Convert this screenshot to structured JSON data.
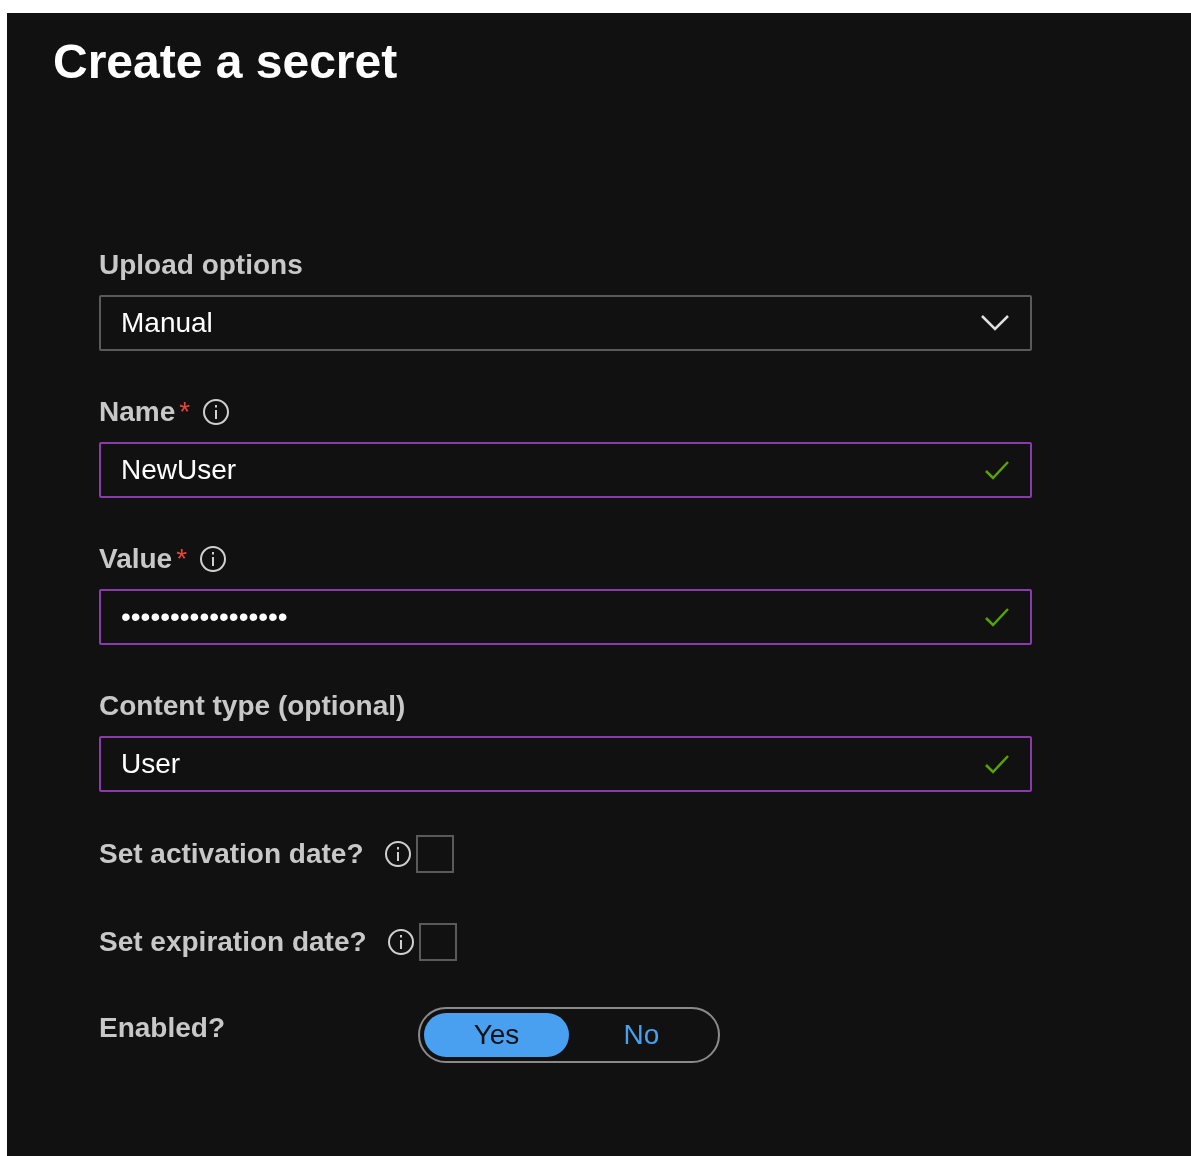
{
  "title": "Create a secret",
  "fields": [
    {
      "kind": "dropdown",
      "label": "Upload options",
      "value": "Manual",
      "info": false,
      "valid": false
    },
    {
      "kind": "text",
      "label": "Name",
      "required_mark": "*",
      "info": true,
      "value": "NewUser",
      "valid": true
    },
    {
      "kind": "text",
      "label": "Value",
      "required_mark": "*",
      "info": true,
      "value": "•••••••••••••••••",
      "valid": true
    },
    {
      "kind": "text",
      "label": "Content type (optional)",
      "info": false,
      "value": "User",
      "valid": true
    }
  ],
  "checkboxes": [
    {
      "label": "Set activation date?",
      "info": true,
      "checked": false
    },
    {
      "label": "Set expiration date?",
      "info": true,
      "checked": false
    }
  ],
  "enabled": {
    "label": "Enabled?",
    "options": [
      {
        "label": "Yes",
        "selected": true
      },
      {
        "label": "No",
        "selected": false
      }
    ]
  }
}
